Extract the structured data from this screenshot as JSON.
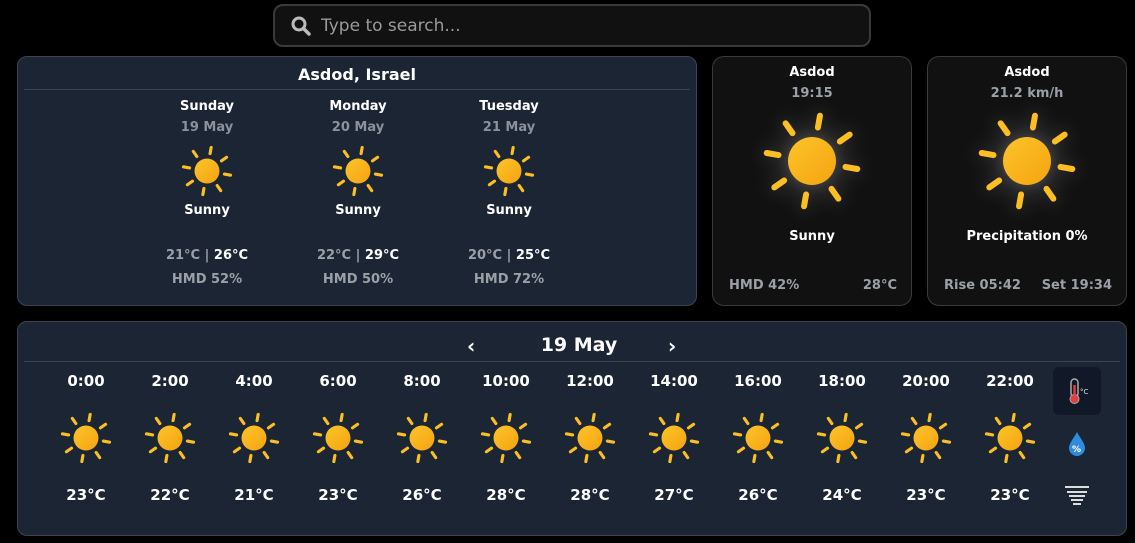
{
  "search": {
    "placeholder": "Type to search..."
  },
  "main": {
    "location": "Asdod, Israel",
    "days": [
      {
        "day": "Sunday",
        "date": "19 May",
        "condition": "Sunny",
        "min": "21°C",
        "max": "26°C",
        "humidity": "HMD 52%"
      },
      {
        "day": "Monday",
        "date": "20 May",
        "condition": "Sunny",
        "min": "22°C",
        "max": "29°C",
        "humidity": "HMD 50%"
      },
      {
        "day": "Tuesday",
        "date": "21 May",
        "condition": "Sunny",
        "min": "20°C",
        "max": "25°C",
        "humidity": "HMD 72%"
      }
    ]
  },
  "current": {
    "city": "Asdod",
    "time": "19:15",
    "condition": "Sunny",
    "humidity": "HMD 42%",
    "temp": "28°C"
  },
  "wind": {
    "city": "Asdod",
    "speed": "21.2 km/h",
    "precipitation": "Precipitation 0%",
    "sunrise": "Rise 05:42",
    "sunset": "Set 19:34"
  },
  "hourly": {
    "date": "19 May",
    "prev": "‹",
    "next": "›",
    "hours": [
      {
        "time": "0:00",
        "temp": "23°C"
      },
      {
        "time": "2:00",
        "temp": "22°C"
      },
      {
        "time": "4:00",
        "temp": "21°C"
      },
      {
        "time": "6:00",
        "temp": "23°C"
      },
      {
        "time": "8:00",
        "temp": "26°C"
      },
      {
        "time": "10:00",
        "temp": "28°C"
      },
      {
        "time": "12:00",
        "temp": "28°C"
      },
      {
        "time": "14:00",
        "temp": "27°C"
      },
      {
        "time": "16:00",
        "temp": "26°C"
      },
      {
        "time": "18:00",
        "temp": "24°C"
      },
      {
        "time": "20:00",
        "temp": "23°C"
      },
      {
        "time": "22:00",
        "temp": "23°C"
      }
    ],
    "modes": [
      {
        "icon": "thermometer-celsius-icon",
        "active": true
      },
      {
        "icon": "humidity-percent-icon",
        "active": false
      },
      {
        "icon": "wind-icon",
        "active": false
      }
    ]
  },
  "colors": {
    "sun": "#fbbf24",
    "panel": "#1c2533",
    "card": "#111111"
  }
}
